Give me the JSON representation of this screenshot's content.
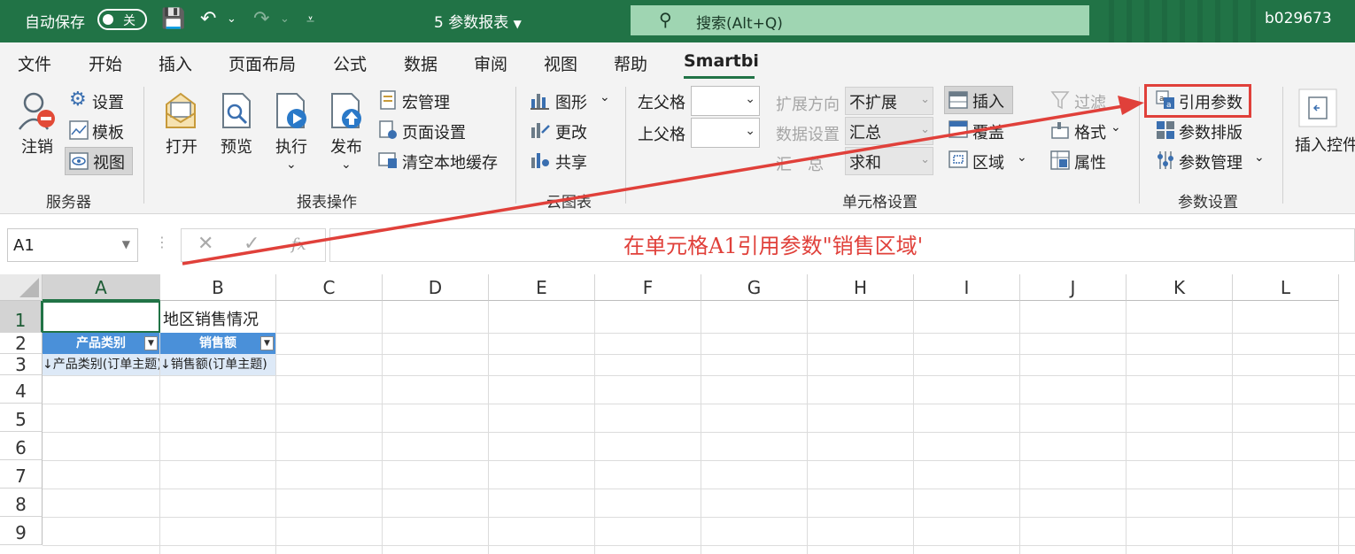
{
  "titlebar": {
    "autosave_label": "自动保存",
    "autosave_state": "关",
    "document_title": "5 参数报表",
    "search_text": "搜索(Alt+Q)",
    "user": "b029673"
  },
  "tabs": [
    "文件",
    "开始",
    "插入",
    "页面布局",
    "公式",
    "数据",
    "审阅",
    "视图",
    "帮助",
    "Smartbi"
  ],
  "active_tab": "Smartbi",
  "ribbon": {
    "server": {
      "logout": "注销",
      "settings": "设置",
      "template": "模板",
      "view": "视图",
      "label": "服务器"
    },
    "report_ops": {
      "open": "打开",
      "preview": "预览",
      "execute": "执行",
      "publish": "发布",
      "macro": "宏管理",
      "page_setup": "页面设置",
      "clear_cache": "清空本地缓存",
      "label": "报表操作"
    },
    "cloud_chart": {
      "chart": "图形",
      "update": "更改",
      "share": "共享",
      "label": "云图表"
    },
    "cell_settings": {
      "left_parent": "左父格",
      "top_parent": "上父格",
      "expand_dir": "扩展方向",
      "expand_val": "不扩展",
      "data_setting": "数据设置",
      "data_val": "汇总",
      "summary": "汇　总",
      "summary_val": "求和",
      "insert": "插入",
      "cover": "覆盖",
      "region": "区域",
      "filter": "过滤",
      "format": "格式",
      "property": "属性",
      "label": "单元格设置"
    },
    "params": {
      "ref": "引用参数",
      "layout": "参数排版",
      "manage": "参数管理",
      "label": "参数设置"
    },
    "insert_ctrl": "插入控件"
  },
  "formula_bar": {
    "name_box": "A1",
    "fx": "fx"
  },
  "annotation": "在单元格A1引用参数\"销售区域'",
  "columns": [
    "A",
    "B",
    "C",
    "D",
    "E",
    "F",
    "G",
    "H",
    "I",
    "J",
    "K",
    "L"
  ],
  "rows": [
    "1",
    "2",
    "3",
    "4",
    "5",
    "6",
    "7",
    "8",
    "9"
  ],
  "cells": {
    "B1": "地区销售情况",
    "A2": "产品类别",
    "B2": "销售额",
    "A3": "↓产品类别(订单主题)",
    "B3": "↓销售额(订单主题)"
  },
  "colors": {
    "excel_green": "#217346",
    "annotation_red": "#e0403a",
    "header_blue": "#4a90d9"
  }
}
